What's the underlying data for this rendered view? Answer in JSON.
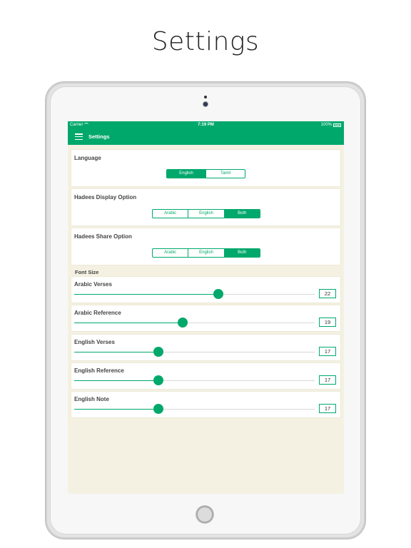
{
  "header": {
    "title": "Settings"
  },
  "status_bar": {
    "carrier": "Carrier",
    "time": "7:19 PM",
    "battery": "100%"
  },
  "navbar": {
    "title": "Settings",
    "menu_icon": "hamburger-menu-icon"
  },
  "colors": {
    "accent": "#00a86b",
    "background": "#f4f1e2"
  },
  "language": {
    "label": "Language",
    "options": [
      "English",
      "Tamil"
    ],
    "selected": "English"
  },
  "hadees_display": {
    "label": "Hadees Display Option",
    "options": [
      "Arabic",
      "English",
      "Both"
    ],
    "selected": "Both"
  },
  "hadees_share": {
    "label": "Hadees Share Option",
    "options": [
      "Arabic",
      "English",
      "Both"
    ],
    "selected": "Both"
  },
  "font_size": {
    "header": "Font Size",
    "min": 10,
    "max": 30,
    "sliders": [
      {
        "label": "Arabic Verses",
        "value": "22",
        "level": 22
      },
      {
        "label": "Arabic Reference",
        "value": "19",
        "level": 19
      },
      {
        "label": "English Verses",
        "value": "17",
        "level": 17
      },
      {
        "label": "English Reference",
        "value": "17",
        "level": 17
      },
      {
        "label": "English Note",
        "value": "17",
        "level": 17
      }
    ]
  }
}
